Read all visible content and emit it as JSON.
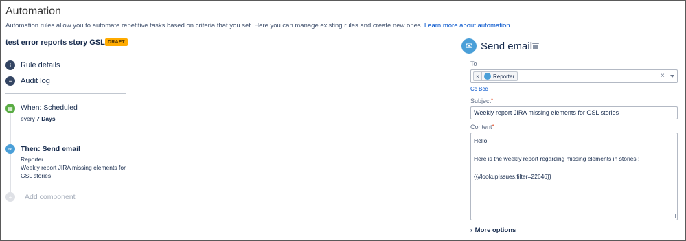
{
  "header": {
    "title": "Automation",
    "description": "Automation rules allow you to automate repetitive tasks based on criteria that you set. Here you can manage existing rules and create new ones.",
    "learn_more": "Learn more about automation"
  },
  "rule": {
    "name": "test error reports story GSL",
    "status": "DRAFT"
  },
  "nav": [
    {
      "label": "Rule details",
      "icon": "info-icon"
    },
    {
      "label": "Audit log",
      "icon": "list-icon"
    }
  ],
  "steps": {
    "trigger": {
      "title": "When: Scheduled",
      "sub_prefix": "every",
      "sub_value": "7 Days",
      "color": "#5aac44"
    },
    "action": {
      "title": "Then: Send email",
      "line1": "Reporter",
      "line2": "Weekly report JIRA missing elements for",
      "line3": "GSL stories",
      "color": "#4a9fd8"
    },
    "add_component": "Add component"
  },
  "panel": {
    "title": "Send email",
    "to_label": "To",
    "to_chip": "Reporter",
    "cc_bcc": "Cc Bcc",
    "subject_label": "Subject",
    "subject_value": "Weekly report JIRA missing elements for GSL stories",
    "content_label": "Content",
    "content_lines": [
      "Hello,",
      "Here is the weekly report regarding missing elements in stories :",
      "{{#lookupIssues.filter=22646}}"
    ],
    "more_options": "More options"
  },
  "colors": {
    "accent_link": "#0052cc",
    "draft_badge": "#ffab00",
    "email_icon": "#4a9fd8",
    "scheduled_icon": "#5aac44",
    "nav_icon": "#344563"
  }
}
